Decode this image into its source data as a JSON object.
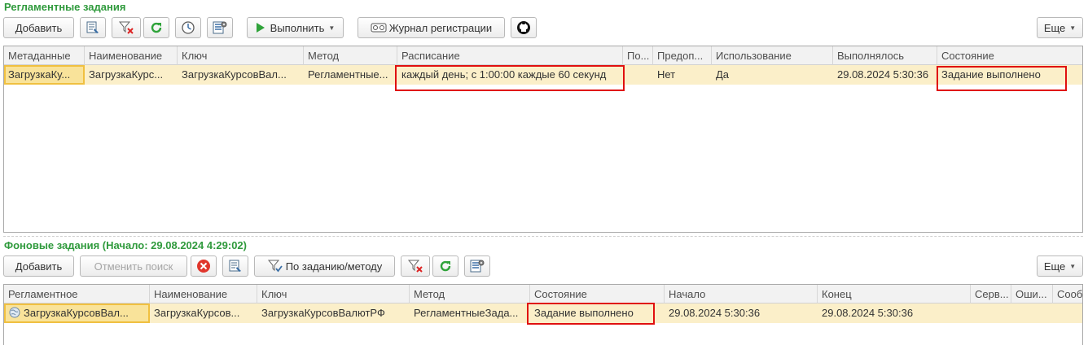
{
  "scheduled": {
    "title": "Регламентные задания",
    "toolbar": {
      "add_label": "Добавить",
      "execute_label": "Выполнить",
      "journal_label": "Журнал регистрации",
      "more_label": "Еще"
    },
    "columns": [
      "Метаданные",
      "Наименование",
      "Ключ",
      "Метод",
      "Расписание",
      "По...",
      "Предоп...",
      "Использование",
      "Выполнялось",
      "Состояние"
    ],
    "rows": [
      [
        "ЗагрузкаКу...",
        "ЗагрузкаКурс...",
        "ЗагрузкаКурсовВал...",
        "Регламентные...",
        "каждый день; с 1:00:00 каждые 60 секунд",
        "",
        "Нет",
        "Да",
        "29.08.2024 5:30:36",
        "Задание выполнено"
      ]
    ]
  },
  "background": {
    "title": "Фоновые задания (Начало: 29.08.2024 4:29:02)",
    "toolbar": {
      "add_label": "Добавить",
      "cancel_search_label": "Отменить поиск",
      "by_task_label": "По заданию/методу",
      "more_label": "Еще"
    },
    "columns": [
      "Регламентное",
      "Наименование",
      "Ключ",
      "Метод",
      "Состояние",
      "Начало",
      "Конец",
      "Серв...",
      "Оши...",
      "Сооб..."
    ],
    "rows": [
      [
        "ЗагрузкаКурсовВал...",
        "ЗагрузкаКурсов...",
        "ЗагрузкаКурсовВалютРФ",
        "РегламентныеЗада...",
        "Задание выполнено",
        "29.08.2024 5:30:36",
        "29.08.2024 5:30:36",
        "",
        "",
        ""
      ]
    ]
  },
  "icons": {
    "change_icon": "list-edit-icon",
    "filter_clear_icon": "filter-clear-icon",
    "refresh_icon": "refresh-icon",
    "schedule_icon": "clock-icon",
    "settings_icon": "settings-list-icon",
    "play_icon": "play-icon",
    "journal_icon": "journal-icon",
    "github_icon": "github-icon",
    "cancel_icon": "cancel-red-icon",
    "row_icon": "globe-task-icon"
  },
  "colors": {
    "section_title": "#2f9a3c",
    "selected_row": "#fbefc9",
    "highlight_box": "#e01010",
    "refresh_green": "#2fa33a",
    "play_green": "#2fa33a"
  }
}
